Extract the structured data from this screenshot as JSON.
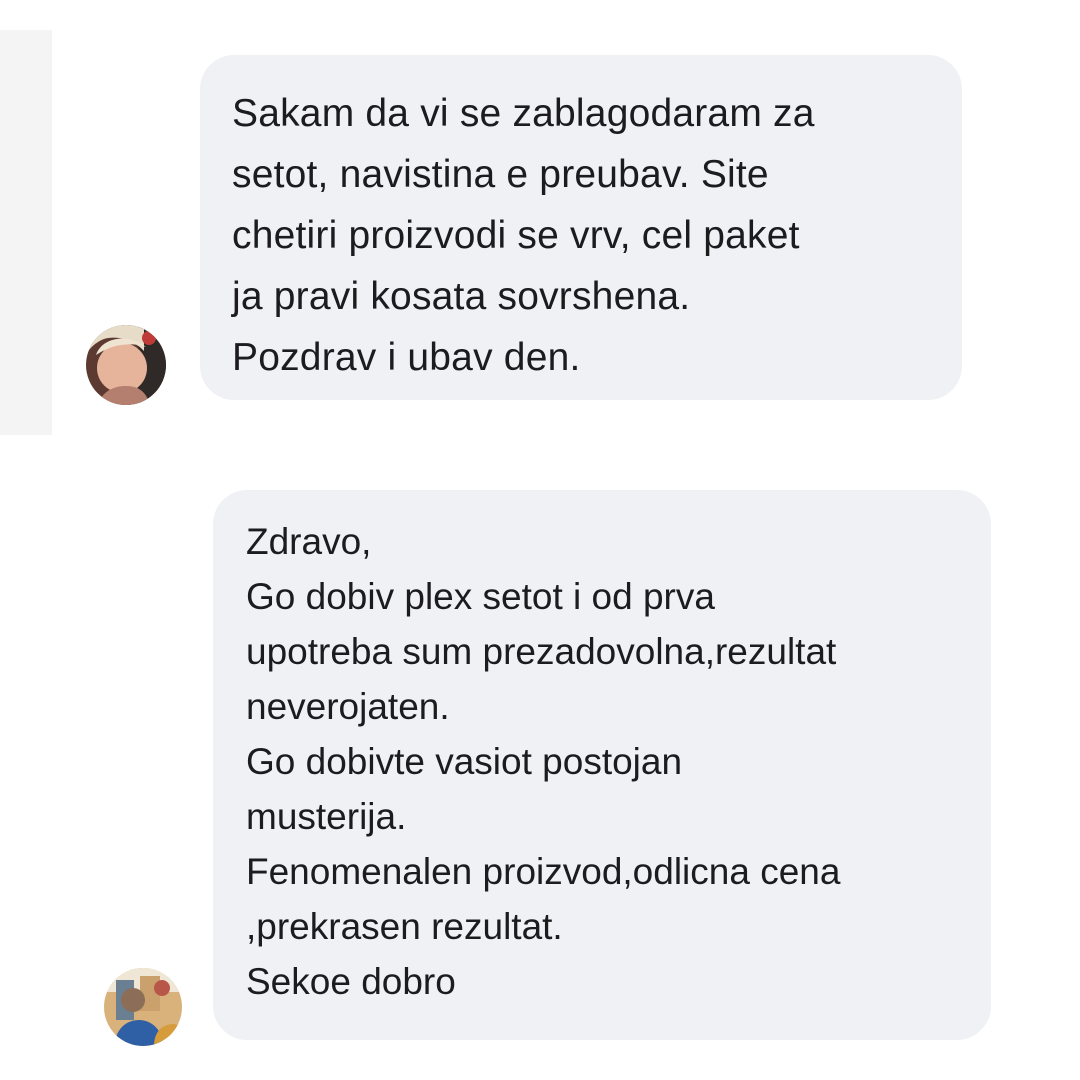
{
  "messages": [
    {
      "avatar_icon": "user-avatar-icon",
      "lines": [
        "Sakam da vi se zablagodaram za",
        "setot, navistina e preubav. Site",
        "chetiri proizvodi se vrv, cel paket",
        "ja pravi kosata sovrshena.",
        "Pozdrav i ubav den."
      ]
    },
    {
      "avatar_icon": "user-avatar-icon",
      "lines": [
        "Zdravo,",
        "Go dobiv plex setot i od prva",
        "upotreba sum prezadovolna,rezultat",
        "neverojaten.",
        "Go dobivte vasiot postojan",
        "musterija.",
        "Fenomenalen proizvod,odlicna cena",
        ",prekrasen rezultat.",
        "Sekoe dobro"
      ]
    }
  ],
  "colors": {
    "bubble": "#f0f1f4",
    "text": "#1c1c1e",
    "background": "#ffffff"
  }
}
